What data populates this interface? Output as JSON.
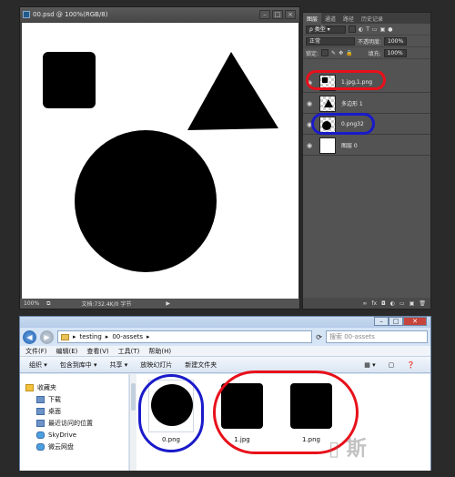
{
  "photoshop": {
    "doc_title": "00.psd @ 100%(RGB/8)",
    "doc_controls": [
      "–",
      "□",
      "×"
    ],
    "zoom": "100%",
    "doc_info": "文档:732.4K/0 字节",
    "panel_tabs": [
      "图层",
      "通道",
      "路径",
      "历史记录"
    ],
    "kind_filter": "类型",
    "blend_mode": "正常",
    "opacity_label": "不透明度:",
    "opacity_value": "100%",
    "lock_label": "锁定:",
    "fill_label": "填充:",
    "fill_value": "100%",
    "layers": [
      {
        "name": "1.jpg,1.png",
        "highlight": "red"
      },
      {
        "name": "多边形 1"
      },
      {
        "name": "0.png32",
        "highlight": "blue"
      },
      {
        "name": "图层 0"
      }
    ],
    "panel_buttons": [
      "∞",
      "fx",
      "◘",
      "◐",
      "▭",
      "▣",
      "🗑"
    ]
  },
  "explorer": {
    "breadcrumb": [
      "testing",
      "00-assets"
    ],
    "search_placeholder": "搜索 00-assets",
    "menu": [
      "文件(F)",
      "编辑(E)",
      "查看(V)",
      "工具(T)",
      "帮助(H)"
    ],
    "toolbar": [
      "组织 ▾",
      "包含到库中 ▾",
      "共享 ▾",
      "放映幻灯片",
      "新建文件夹"
    ],
    "sidebar": [
      {
        "label": "收藏夹",
        "icon": "star-icon",
        "head": true
      },
      {
        "label": "下载",
        "icon": "download-folder-icon"
      },
      {
        "label": "桌面",
        "icon": "desktop-icon"
      },
      {
        "label": "最近访问的位置",
        "icon": "recent-places-icon"
      },
      {
        "label": "SkyDrive",
        "icon": "cloud-icon"
      },
      {
        "label": "微云网盘",
        "icon": "cloud-drive-icon"
      }
    ],
    "files": [
      {
        "name": "0.png",
        "shape": "circle"
      },
      {
        "name": "1.jpg",
        "shape": "square"
      },
      {
        "name": "1.png",
        "shape": "square"
      }
    ]
  },
  "annotation_colors": {
    "red": "#e8101a",
    "blue": "#1a1aca"
  }
}
